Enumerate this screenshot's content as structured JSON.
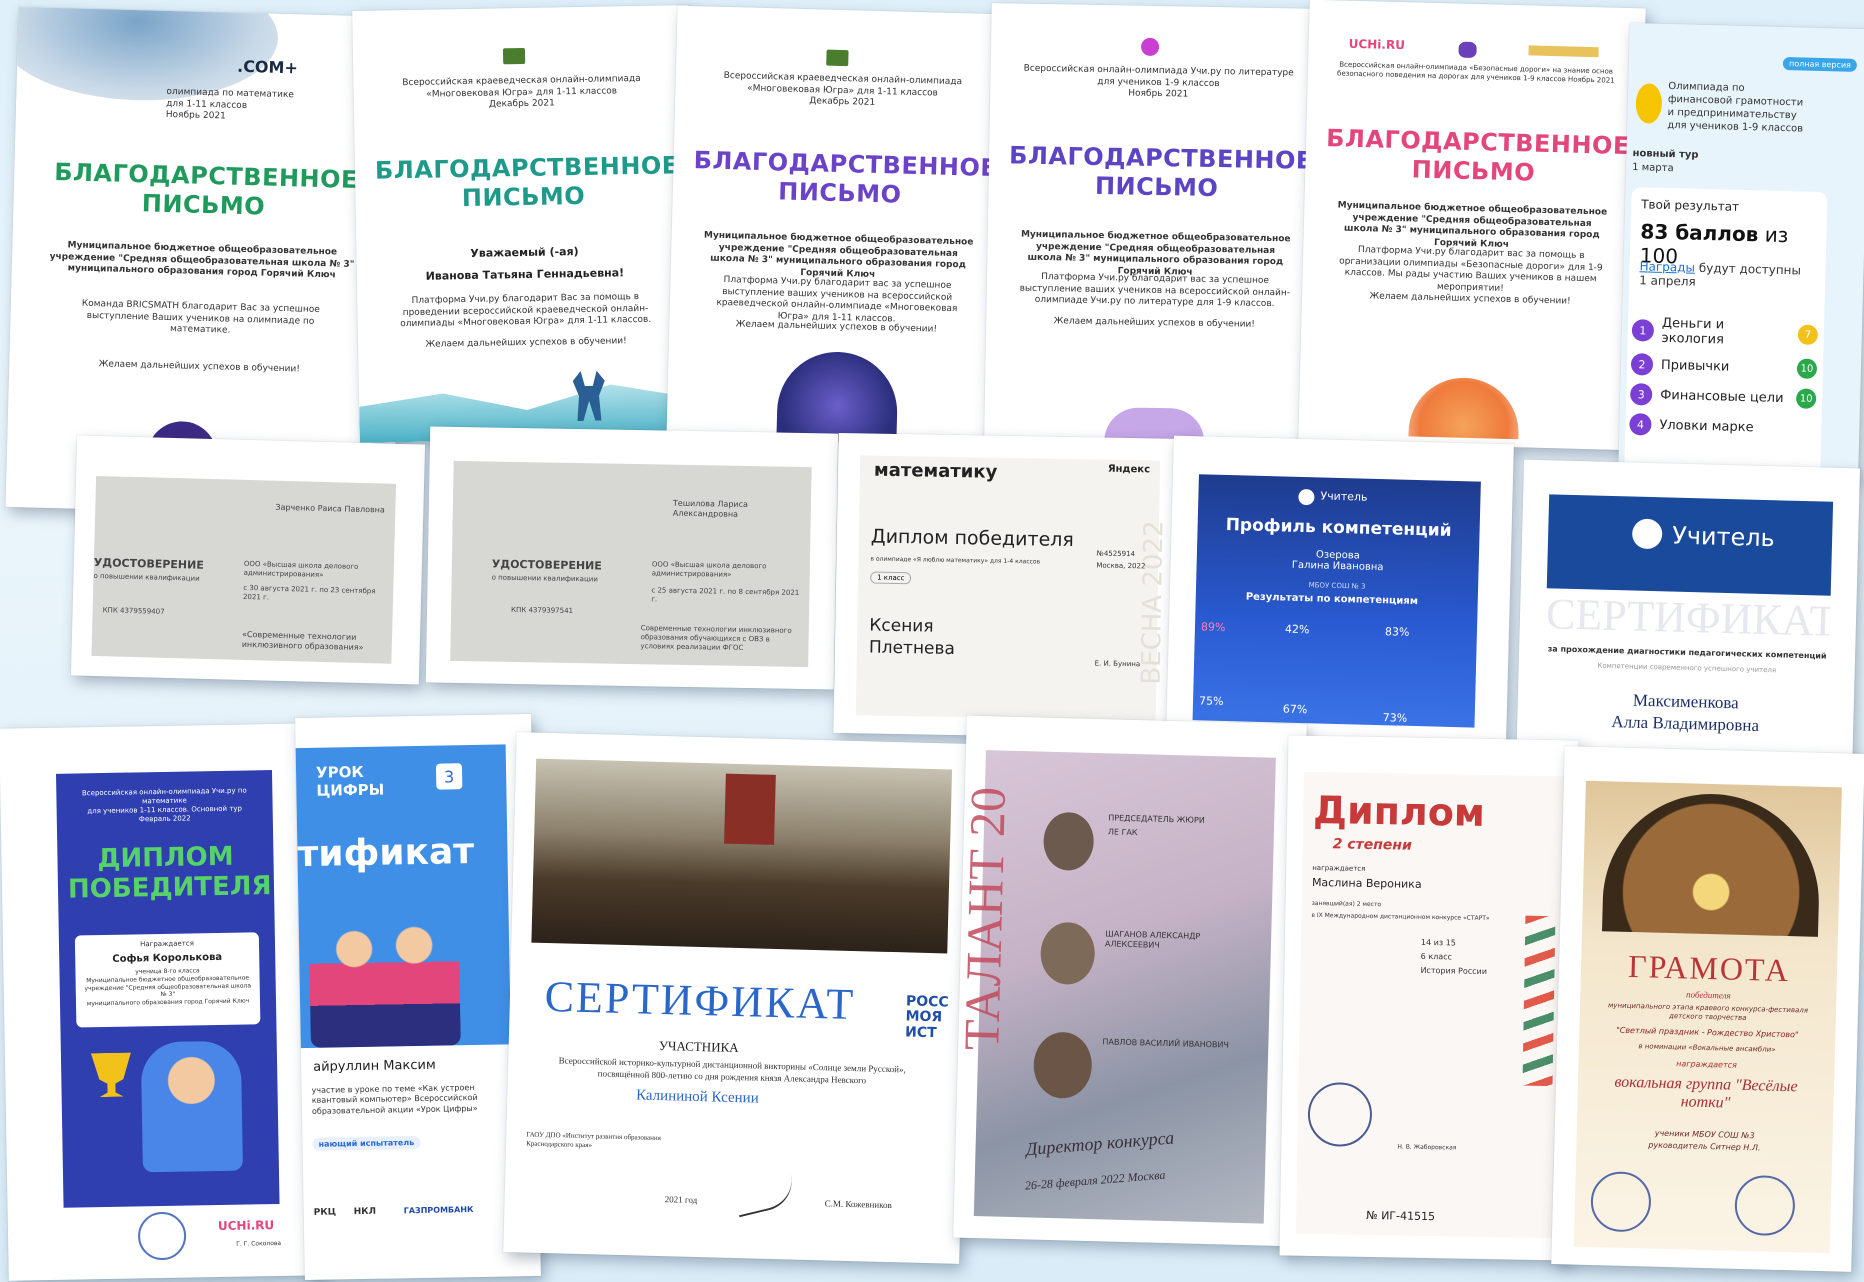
{
  "top_row": {
    "c1": {
      "brand": ".COM+",
      "header": "олимпиада по математике\nдля 1-11 классов\nНоябрь 2021",
      "title": "БЛАГОДАРСТВЕННОЕ ПИСЬМО",
      "org": "Муниципальное бюджетное общеобразовательное учреждение \"Средняя общеобразовательная школа № 3\" муниципального образования город Горячий Ключ",
      "text": "Команда BRICSMATH благодарит Вас за успешное выступление Ваших учеников на олимпиаде по математике.",
      "wish": "Желаем дальнейших успехов в обучении!"
    },
    "c2": {
      "header": "Всероссийская краеведческая онлайн-олимпиада\n«Многовековая Югра» для 1-11 классов\nДекабрь 2021",
      "title": "БЛАГОДАРСТВЕННОЕ ПИСЬМО",
      "greeting": "Уважаемый (-ая)",
      "name": "Иванова Татьяна Геннадьевна!",
      "text": "Платформа Учи.ру благодарит Вас за помощь в проведении всероссийской краеведческой онлайн-олимпиады «Многовековая Югра» для 1-11 классов.",
      "wish": "Желаем дальнейших успехов в обучении!"
    },
    "c3": {
      "header": "Всероссийская краеведческая онлайн-олимпиада\n«Многовековая Югра» для 1-11 классов\nДекабрь 2021",
      "title": "БЛАГОДАРСТВЕННОЕ ПИСЬМО",
      "org": "Муниципальное бюджетное общеобразовательное учреждение \"Средняя общеобразовательная школа № 3\" муниципального образования город Горячий Ключ",
      "text": "Платформа Учи.ру благодарит вас за успешное выступление ваших учеников на всероссийской краеведческой онлайн-олимпиаде «Многовековая Югра» для 1-11 классов.",
      "wish": "Желаем дальнейших успехов в обучении!"
    },
    "c4": {
      "header": "Всероссийская онлайн-олимпиада Учи.ру по литературе\nдля учеников 1-9 классов\nНоябрь 2021",
      "title": "БЛАГОДАРСТВЕННОЕ ПИСЬМО",
      "org": "Муниципальное бюджетное общеобразовательное учреждение \"Средняя общеобразовательная школа № 3\" муниципального образования город Горячий Ключ",
      "text": "Платформа Учи.ру благодарит вас за успешное выступление ваших учеников на всероссийской онлайн-олимпиаде Учи.ру по литературе для 1-9 классов.",
      "wish": "Желаем дальнейших успехов в обучении!"
    },
    "c5": {
      "brand": "UCHi.RU",
      "header": "Всероссийская онлайн-олимпиада «Безопасные дороги» на знание основ безопасного поведения на дорогах для учеников 1-9 классов\nНоябрь 2021",
      "title": "БЛАГОДАРСТВЕННОЕ ПИСЬМО",
      "org": "Муниципальное бюджетное общеобразовательное учреждение \"Средняя общеобразовательная школа № 3\" муниципального образования город Горячий Ключ",
      "text": "Платформа Учи.ру благодарит вас за помощь в организации олимпиады «Безопасные дороги» для 1-9 классов. Мы рады участию Ваших учеников в нашем мероприятии!",
      "wish": "Желаем дальнейших успехов в обучении!"
    },
    "c6": {
      "version": "полная версия",
      "olymp": "Олимпиада по финансовой грамотности и предпринимательству для учеников 1-9 классов",
      "tour": "новный тур",
      "date": "1 марта",
      "result_label": "Твой результат",
      "score": "83 баллов",
      "score_of": "из 100",
      "awards_link": "Награды",
      "awards_text": "будут доступны 1 апреля",
      "items": [
        {
          "n": "1",
          "label": "Деньги и экология",
          "v": "7",
          "color": "#f2c21b"
        },
        {
          "n": "2",
          "label": "Привычки",
          "v": "10",
          "color": "#2aa84a"
        },
        {
          "n": "3",
          "label": "Финансовые цели",
          "v": "10",
          "color": "#2aa84a"
        },
        {
          "n": "4",
          "label": "Уловки марке",
          "v": "",
          "color": "#f2c21b"
        }
      ]
    }
  },
  "mid_row": {
    "u1": {
      "name": "Зарченко Раиса Павловна",
      "title": "УДОСТОВЕРЕНИЕ",
      "sub": "о повышении квалификации",
      "num": "КПК 4379559407",
      "org": "ООО «Высшая школа делового администрирования»",
      "dates": "с 30 августа 2021 г. по 23 сентября 2021 г.",
      "course": "«Современные технологии инклюзивного образования»"
    },
    "u2": {
      "name": "Тешилова Лариса Александровна",
      "title": "УДОСТОВЕРЕНИЕ",
      "sub": "о повышении квалификации",
      "num": "КПК 4379397541",
      "org": "ООО «Высшая школа делового администрирования»",
      "dates": "с 25 августа 2021 г. по 8 сентября 2021 г.",
      "course": "Современные технологии инклюзивного образования обучающихся с ОВЗ в условиях реализации ФГОС"
    },
    "d3": {
      "top": "математику",
      "brand": "Яндекс",
      "title": "Диплом победителя",
      "sub": "в олимпиаде «Я люблю математику» для 1-4 классов",
      "grade": "1 класс",
      "first": "Ксения",
      "last": "Плетнева",
      "num": "№4525914",
      "city": "Москва, 2022",
      "sign": "Е. И. Бунина",
      "season": "ВЕСНА 2022"
    },
    "d4": {
      "brand": "Учитель",
      "title": "Профиль компетенций",
      "person": "Озерова\nГалина Ивановна",
      "school": "МБОУ СОШ № 3",
      "results": "Результаты по компетенциям",
      "p1": "89%",
      "p2": "42%",
      "p3": "83%",
      "p4": "75%",
      "p5": "67%",
      "p6": "73%"
    },
    "d5": {
      "brand": "Учитель",
      "title": "СЕРТИФИКАТ",
      "sub": "за прохождение диагностики педагогических компетенций",
      "sub2": "Компетенции современного успешного учителя",
      "name1": "Максименкова",
      "name2": "Алла Владимировна"
    }
  },
  "bottom_row": {
    "b1": {
      "header": "Всероссийская онлайн-олимпиада Учи.ру по математике\nдля учеников 1-11 классов. Основной тур\nФевраль 2022",
      "title": "ДИПЛОМ ПОБЕДИТЕЛЯ",
      "award": "Награждается",
      "name": "Софья Королькова",
      "info": "ученица 8-го класса\nМуниципальное бюджетное общеобразовательное учреждение \"Средняя общеобразовательная школа № 3\"\nмуниципального образования город Горячий Ключ",
      "brand": "UCHi.RU",
      "sign": "Г. Г. Соколова"
    },
    "b2": {
      "brand1": "УРОК",
      "brand2": "ЦИФРЫ",
      "badge": "3",
      "title": "тификат",
      "name": "айруллин Максим",
      "text": "участие в уроке по теме «Как устроен квантовый компьютер» Всероссийской образовательной акции «Урок Цифры»",
      "role": "нающий испытатель",
      "p1": "РКЦ",
      "p2": "НКЛ",
      "p3": "ГАЗПРОМБАНК"
    },
    "b3": {
      "title": "СЕРТИФИКАТ",
      "side": "РОСС МОЯ ИСТ",
      "role": "УЧАСТНИКА",
      "text": "Всероссийской историко-культурной дистанционной викторины «Солнце земли Русской», посвящённой 800-летию со дня рождения князя Александра Невского",
      "name": "Калининой Ксении",
      "org": "ГАОУ ДПО «Институт развития образования Краснодарского края»",
      "year": "2021 год",
      "sign": "С.М. Кожевников"
    },
    "b4": {
      "side": "ТАЛАНТ 20",
      "t1": "ПРЕДСЕДАТЕЛЬ ЖЮРИ",
      "t2": "ЛЕ ГАК",
      "t3": "ШАГАНОВ АЛЕКСАНДР АЛЕКСЕЕВИЧ",
      "t4": "ПАВЛОВ ВАСИЛИЙ ИВАНОВИЧ",
      "sign": "Директор конкурса",
      "date": "26-28 февраля 2022 Москва"
    },
    "b5": {
      "title": "Диплом",
      "degree": "2 степени",
      "award": "награждается",
      "name": "Маслина Вероника",
      "place": "занявший(ая) 2 место",
      "contest": "в IX Международном дистанционном конкурсе «СТАРТ»",
      "score": "14 из 15",
      "grade": "6 класс",
      "subject": "История России",
      "sign": "Н. В. Жаборовская",
      "num": "№ ИГ-41515"
    },
    "b6": {
      "title": "ГРАМОТА",
      "sub": "победителя",
      "text": "муниципального этапа краевого конкурса-фестиваля детского творчества",
      "fest": "\"Светлый праздник - Рождество Христово\"",
      "nom": "в номинации «Вокальные ансамбли»",
      "award": "награждается",
      "group": "вокальная группа \"Весёлые нотки\"",
      "who": "ученики МБОУ СОШ №3",
      "lead": "руководитель Ситнер Н.Л."
    }
  },
  "colors": {
    "green": "#1f9a5b",
    "purple": "#6b43c8",
    "violet": "#5d44c4",
    "pink": "#e2467a",
    "blue": "#2a67d9",
    "navy": "#1e3c8f"
  }
}
